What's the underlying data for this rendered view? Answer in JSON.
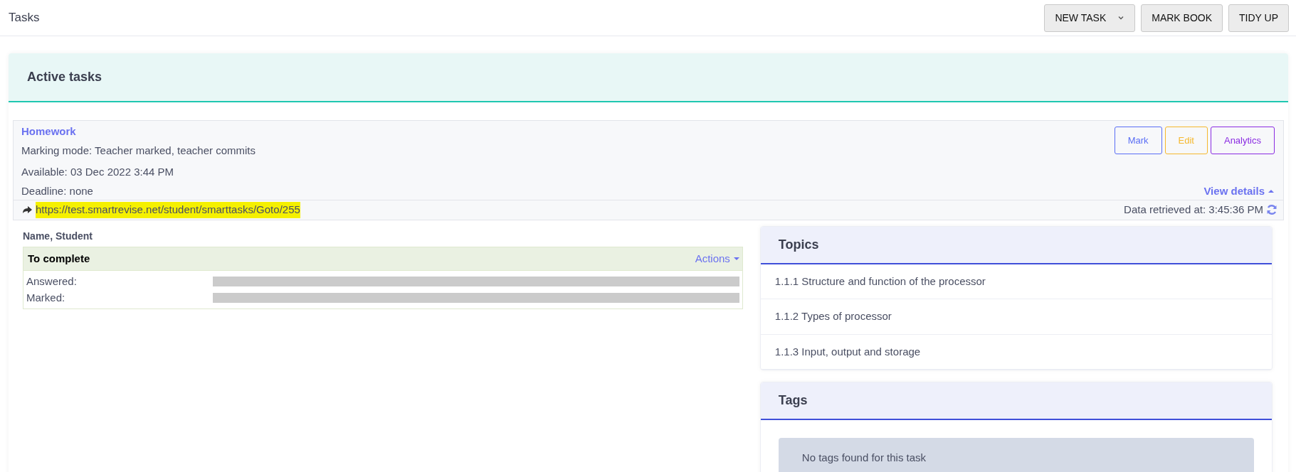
{
  "page": {
    "title": "Tasks"
  },
  "toolbar": [
    {
      "label": "NEW TASK",
      "kind": "dropdown"
    },
    {
      "label": "MARK BOOK",
      "kind": "button"
    },
    {
      "label": "TIDY UP",
      "kind": "button"
    }
  ],
  "panel": {
    "title": "Active tasks"
  },
  "task": {
    "name": "Homework",
    "marking_mode": "Marking mode: Teacher marked, teacher commits",
    "available": "Available: 03 Dec 2022 3:44 PM",
    "deadline": "Deadline: none",
    "actions": [
      {
        "label": "Mark",
        "color": "#5a6ef5"
      },
      {
        "label": "Edit",
        "color": "#f5b82e"
      },
      {
        "label": "Analytics",
        "color": "#8a2be2"
      }
    ],
    "view_details": {
      "label": "View details",
      "expanded": true
    },
    "link": {
      "url": "https://test.smartrevise.net/student/smarttasks/Goto/255",
      "highlighted": true
    },
    "retrieved": "Data retrieved at: 3:45:36 PM"
  },
  "student": {
    "name": "Name, Student",
    "status": "To complete",
    "actions_label": "Actions",
    "progress": [
      {
        "label": "Answered:",
        "level": 0
      },
      {
        "label": "Marked:",
        "level": 0
      }
    ]
  },
  "topics": {
    "title": "Topics",
    "items": [
      "1.1.1 Structure and function of the processor",
      "1.1.2 Types of processor",
      "1.1.3 Input, output and storage"
    ]
  },
  "tags": {
    "title": "Tags",
    "empty_message": "No tags found for this task"
  }
}
